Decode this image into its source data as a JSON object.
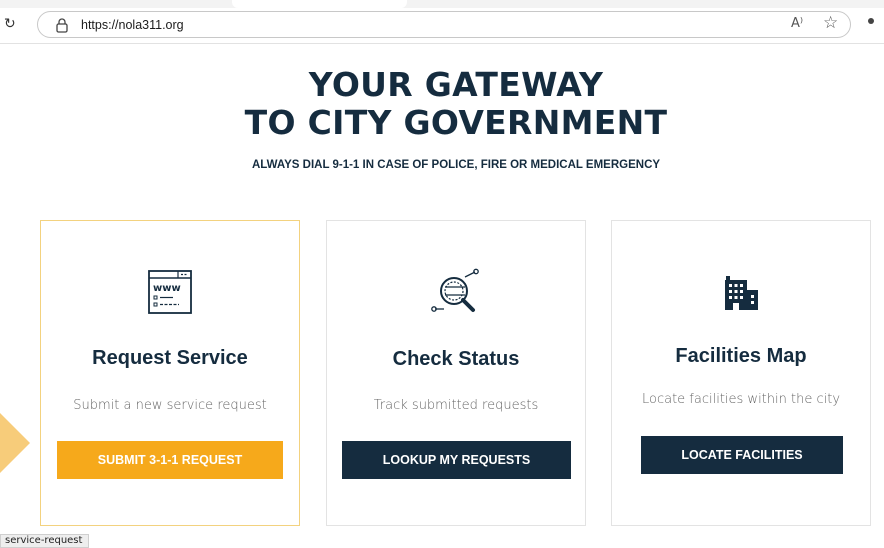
{
  "browser": {
    "url": "https://nola311.org",
    "reload_glyph": "↻",
    "read_aloud_glyph": "A⁾",
    "favorite_glyph": "☆"
  },
  "hero": {
    "title_line1": "YOUR GATEWAY",
    "title_line2": "TO CITY GOVERNMENT",
    "subtitle": "ALWAYS DIAL 9-1-1 IN CASE OF POLICE, FIRE OR MEDICAL EMERGENCY"
  },
  "cards": [
    {
      "icon": "website-icon",
      "title": "Request Service",
      "description": "Submit a new service request",
      "button_label": "SUBMIT 3-1-1 REQUEST",
      "button_color": "#f6a91b"
    },
    {
      "icon": "magnifier-search-icon",
      "title": "Check Status",
      "description": "Track submitted requests",
      "button_label": "LOOKUP MY REQUESTS",
      "button_color": "#152c3f"
    },
    {
      "icon": "buildings-icon",
      "title": "Facilities Map",
      "description": "Locate facilities within the city",
      "button_label": "LOCATE FACILITIES",
      "button_color": "#152c3f"
    }
  ],
  "status_bar": {
    "link_text": "service-request"
  },
  "colors": {
    "navy": "#152c3f",
    "accent_yellow": "#f6a91b",
    "highlight_border": "#f3d27f"
  }
}
